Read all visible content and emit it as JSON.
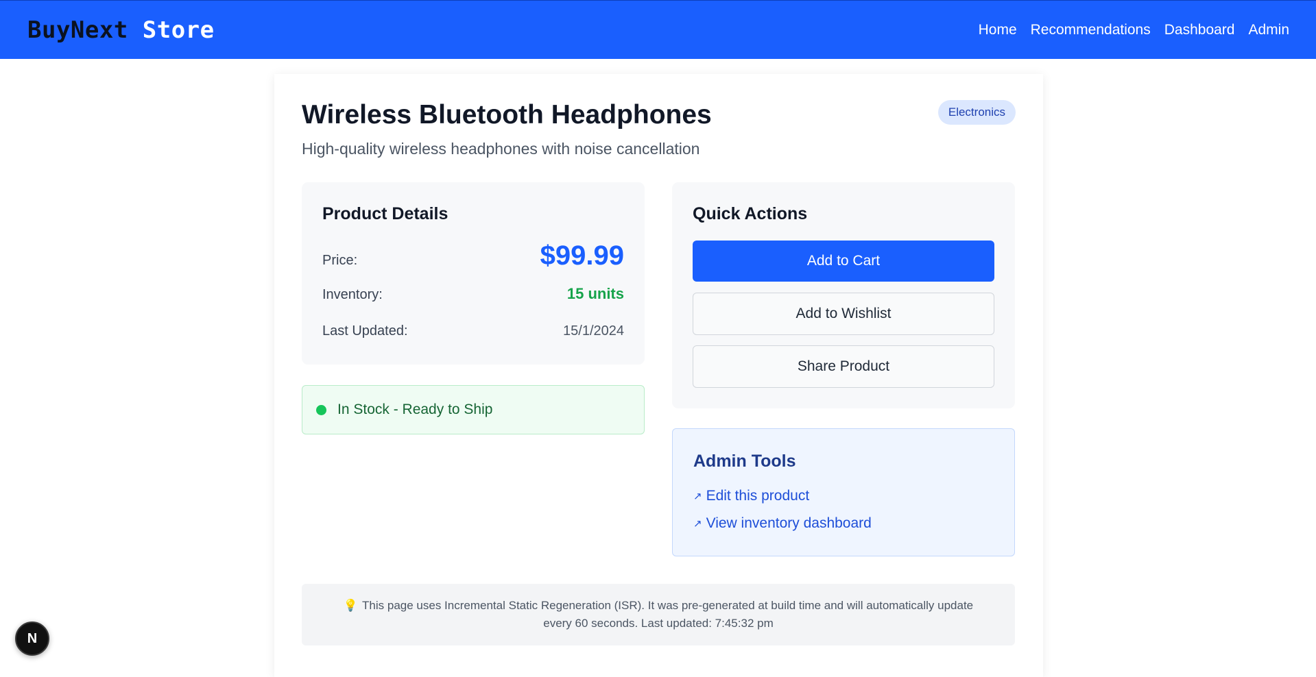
{
  "header": {
    "brand_part1": "BuyNext",
    "brand_part2": " Store",
    "nav": [
      "Home",
      "Recommendations",
      "Dashboard",
      "Admin"
    ]
  },
  "product": {
    "title": "Wireless Bluetooth Headphones",
    "description": "High-quality wireless headphones with noise cancellation",
    "category": "Electronics"
  },
  "details": {
    "heading": "Product Details",
    "price_label": "Price:",
    "price": "$99.99",
    "inventory_label": "Inventory:",
    "inventory": "15 units",
    "updated_label": "Last Updated:",
    "updated": "15/1/2024"
  },
  "stock": {
    "status": "In Stock - Ready to Ship",
    "color": "#16c55a"
  },
  "actions": {
    "heading": "Quick Actions",
    "add_to_cart": "Add to Cart",
    "add_to_wishlist": "Add to Wishlist",
    "share": "Share Product"
  },
  "admin": {
    "heading": "Admin Tools",
    "arrow": "↗",
    "edit": "Edit this product",
    "inventory": "View inventory dashboard"
  },
  "note": {
    "icon": "💡",
    "text": "This page uses Incremental Static Regeneration (ISR). It was pre-generated at build time and will automatically update every 60 seconds. Last updated: 7:45:32 pm"
  },
  "devtools": {
    "label": "N"
  },
  "colors": {
    "accent": "#1a5ffe",
    "success": "#16a34a",
    "admin": "#1d4ed8"
  }
}
